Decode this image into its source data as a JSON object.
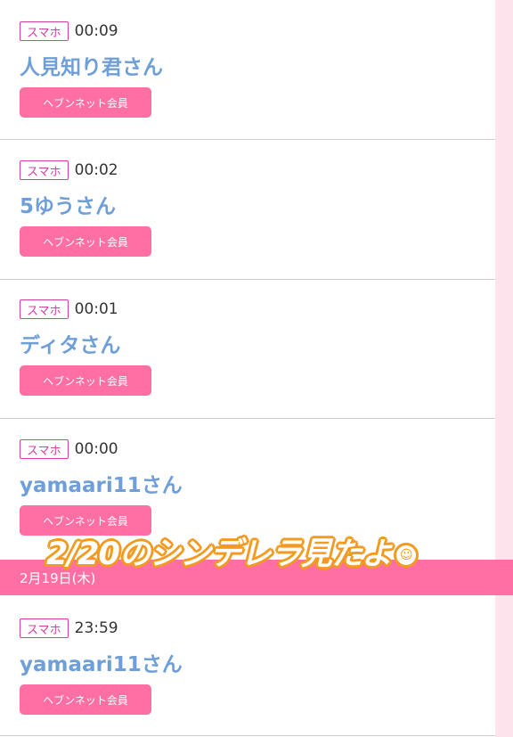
{
  "visits": [
    {
      "device": "スマホ",
      "time": "00:09",
      "name": "人見知り君さん",
      "member_label": "ヘブンネット会員"
    },
    {
      "device": "スマホ",
      "time": "00:02",
      "name": "5ゆうさん",
      "member_label": "ヘブンネット会員"
    },
    {
      "device": "スマホ",
      "time": "00:01",
      "name": "ディタさん",
      "member_label": "ヘブンネット会員"
    },
    {
      "device": "スマホ",
      "time": "00:00",
      "name": "yamaari11さん",
      "member_label": "ヘブンネット会員"
    }
  ],
  "date_divider": "2月19日(木)",
  "visits_prev_day": [
    {
      "device": "スマホ",
      "time": "23:59",
      "name": "yamaari11さん",
      "member_label": "ヘブンネット会員"
    }
  ],
  "overlay_caption": "2/20のシンデレラ見たよ",
  "colors": {
    "accent_pink": "#ff6fa3",
    "name_blue": "#6f9fd8",
    "badge_magenta": "#d43fa0",
    "overlay_orange": "#f39a1f"
  }
}
